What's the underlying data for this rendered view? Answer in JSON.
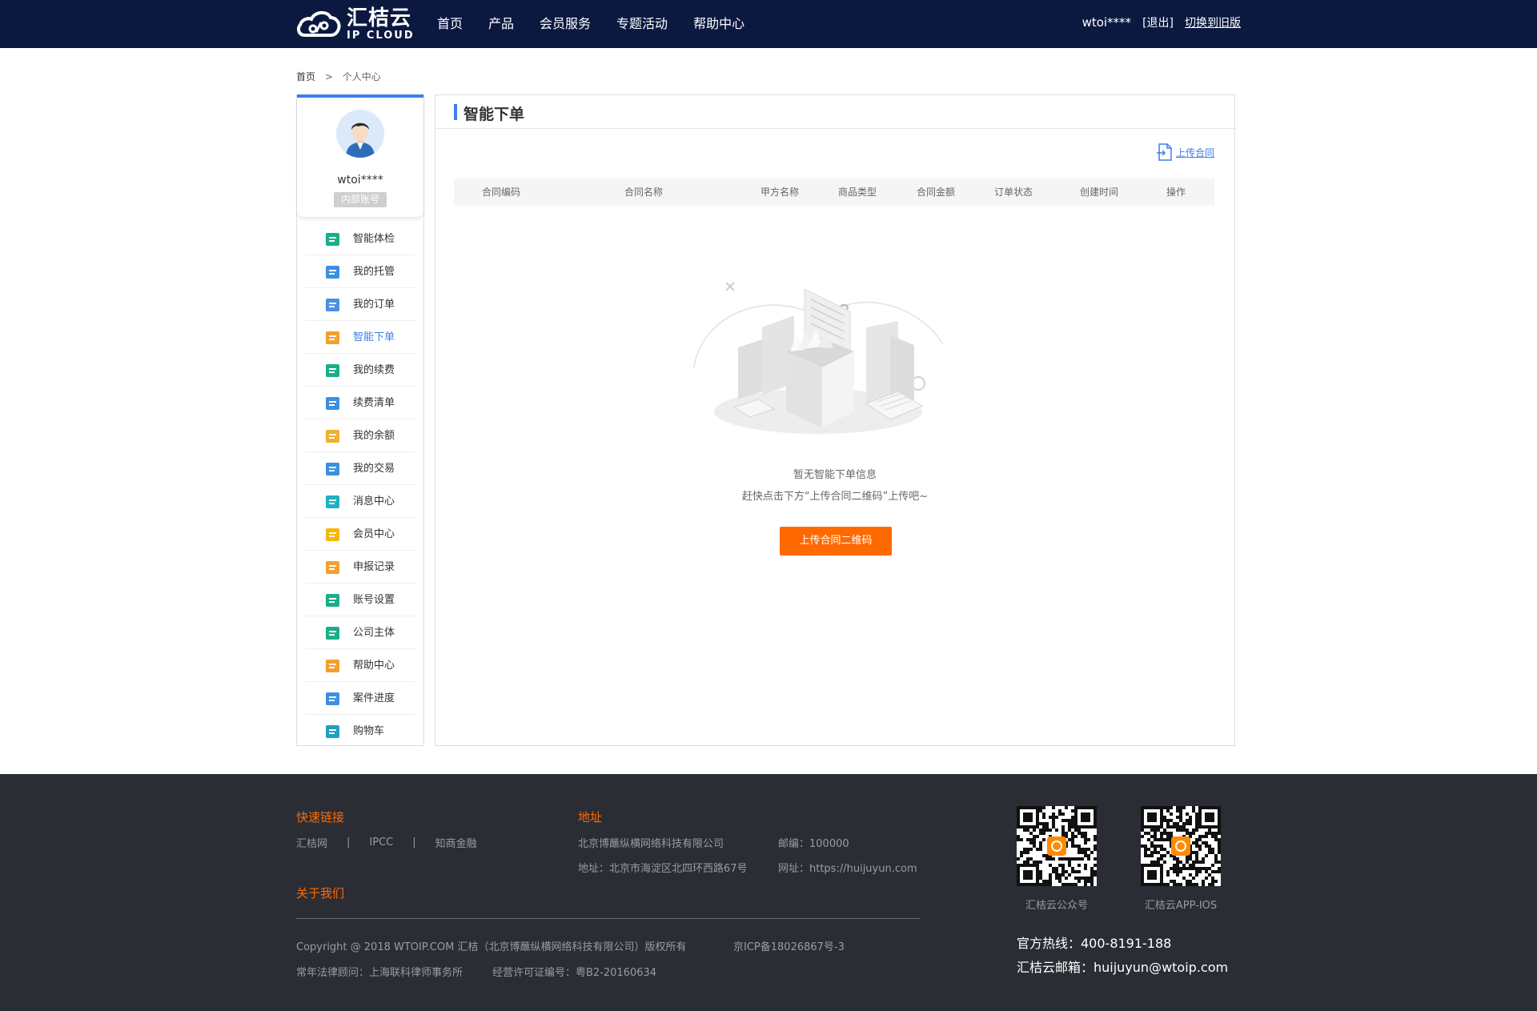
{
  "header": {
    "logo_cn": "汇桔云",
    "logo_en": "IP CLOUD",
    "nav": [
      "首页",
      "产品",
      "会员服务",
      "专题活动",
      "帮助中心"
    ],
    "username": "wtoi****",
    "logout": "[退出]",
    "switch_old": "切换到旧版"
  },
  "breadcrumb": {
    "home": "首页",
    "sep": ">",
    "current": "个人中心"
  },
  "sidebar": {
    "name": "wtoi****",
    "badge": "内部账号",
    "items": [
      {
        "label": "智能体检",
        "icon": "medkit-icon",
        "color": "#1aae88"
      },
      {
        "label": "我的托管",
        "icon": "hosting-icon",
        "color": "#3d8fe0"
      },
      {
        "label": "我的订单",
        "icon": "order-icon",
        "color": "#4a90e2"
      },
      {
        "label": "智能下单",
        "icon": "smart-order-icon",
        "color": "#f0a030",
        "active": true
      },
      {
        "label": "我的续费",
        "icon": "renew-icon",
        "color": "#1aae88"
      },
      {
        "label": "续费清单",
        "icon": "renew-list-icon",
        "color": "#3d8fe0"
      },
      {
        "label": "我的余额",
        "icon": "wallet-icon",
        "color": "#f0b030"
      },
      {
        "label": "我的交易",
        "icon": "trade-icon",
        "color": "#3d8fe0"
      },
      {
        "label": "消息中心",
        "icon": "message-icon",
        "color": "#20b0c0"
      },
      {
        "label": "会员中心",
        "icon": "crown-icon",
        "color": "#f5b800"
      },
      {
        "label": "申报记录",
        "icon": "report-icon",
        "color": "#f0a030"
      },
      {
        "label": "账号设置",
        "icon": "user-settings-icon",
        "color": "#1aae88"
      },
      {
        "label": "公司主体",
        "icon": "company-icon",
        "color": "#1aae88"
      },
      {
        "label": "帮助中心",
        "icon": "help-icon",
        "color": "#f0a030"
      },
      {
        "label": "案件进度",
        "icon": "progress-icon",
        "color": "#3d8fe0"
      },
      {
        "label": "购物车",
        "icon": "cart-icon",
        "color": "#20a0c0"
      }
    ]
  },
  "main": {
    "title": "智能下单",
    "upload_contract": "上传合同",
    "columns": [
      "合同编码",
      "合同名称",
      "甲方名称",
      "商品类型",
      "合同金额",
      "订单状态",
      "创建时间",
      "操作"
    ],
    "empty_line1": "暂无智能下单信息",
    "empty_line2": "赶快点击下方“上传合同二维码”上传吧~",
    "upload_qr_button": "上传合同二维码"
  },
  "footer": {
    "quick_links_title": "快速链接",
    "links": [
      "汇桔网",
      "IPCC",
      "知商金融"
    ],
    "about_title": "关于我们",
    "address_title": "地址",
    "company": "北京博蘸纵横网络科技有限公司",
    "postcode": "邮编：100000",
    "address": "地址：北京市海淀区北四环西路67号",
    "website": "网址：https://huijuyun.com",
    "copyright": "Copyright @ 2018 WTOIP.COM 汇桔（北京博蘸纵横网络科技有限公司）版权所有",
    "icp": "京ICP备18026867号-3",
    "lawyer": "常年法律顾问：上海联科律师事务所",
    "license": "经营许可证编号：粤B2-20160634",
    "qr1_caption": "汇桔云公众号",
    "qr2_caption": "汇桔云APP-IOS",
    "hotline": "官方热线：400-8191-188",
    "email": "汇桔云邮箱：huijuyun@wtoip.com"
  },
  "colors": {
    "header_bg": "#0b1941",
    "accent": "#3d7ef0",
    "button": "#ff6a00",
    "footer_bg": "#2b2d35"
  }
}
